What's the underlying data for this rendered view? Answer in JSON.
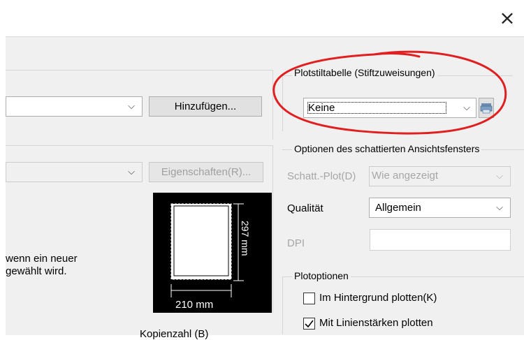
{
  "window": {
    "close_glyph": "×"
  },
  "pen_table": {
    "group_title": "Plotstiltabelle (Stiftzuweisungen)",
    "selected": "Keine",
    "edit_icon": "printer-edit-icon"
  },
  "printer": {
    "add_button": "Hinzufügen...",
    "properties_button": "Eigenschaften(R)..."
  },
  "shaded_viewport": {
    "group_title": "Optionen des schattierten Ansichtsfensters",
    "shade_label": "Schatt.-Plot(D)",
    "shade_value": "Wie angezeigt",
    "quality_label": "Qualität",
    "quality_value": "Allgemein",
    "dpi_label": "DPI",
    "dpi_value": ""
  },
  "notice": {
    "line1": "wenn ein neuer",
    "line2": "gewählt wird."
  },
  "paper_preview": {
    "height_label": "297 mm",
    "width_label": "210 mm"
  },
  "plot_options": {
    "group_title": "Plotoptionen",
    "background": {
      "label": "Im Hintergrund plotten(K)",
      "checked": false
    },
    "lineweights": {
      "label": "Mit Linienstärken plotten",
      "checked": true
    }
  },
  "copies": {
    "label": "Kopienzahl (B)"
  },
  "annotation": {
    "color": "#e02020"
  }
}
